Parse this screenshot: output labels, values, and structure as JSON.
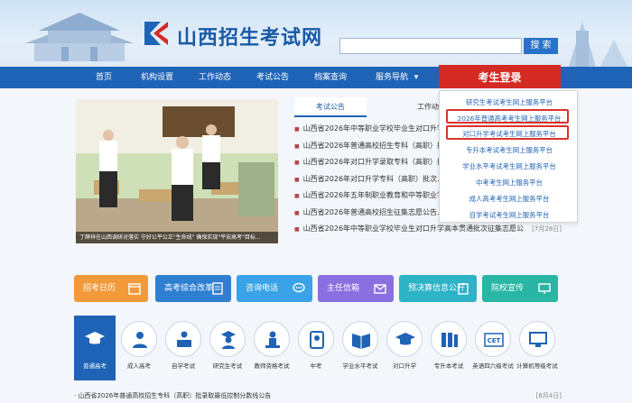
{
  "header": {
    "site_title": "山西招生考试网",
    "search_placeholder": "",
    "search_button": "搜 索"
  },
  "nav": {
    "items": [
      "首页",
      "机构设置",
      "工作动态",
      "考试公告",
      "档案查询",
      "服务导航"
    ],
    "dropdown_caret": "▾",
    "login_label": "考生登录"
  },
  "photo": {
    "caption": "丁薛祥在山西调研对落实 守好公平公正\"生命线\" 确保实现\"平安高考\"目标..."
  },
  "news": {
    "tabs": [
      "考试公告",
      "工作动"
    ],
    "items": [
      {
        "title": "山西省2026年中等职业学校毕业生对口升学…"
      },
      {
        "title": "山西省2026年普通高校招生专科（高职）批…"
      },
      {
        "title": "山西省2026年对口升学录取专科（高职）批次录…"
      },
      {
        "title": "山西省2026年对口升学专科（高职）批次…"
      },
      {
        "title": "山西省2026年五年制职业教育和中等职业学…"
      },
      {
        "title": "山西省2026年普通高校招生征集志愿公告…"
      },
      {
        "title": "山西省2026年中等职业学校毕业生对口升学高本贯通批次征集志愿公"
      }
    ],
    "last_date": "[7月28日]"
  },
  "dropdown": {
    "items": [
      "研究生考试考生网上服务平台",
      "2026年普通高考考生网上服务平台",
      "对口升学考试考生网上服务平台",
      "专升本考试考生网上服务平台",
      "学业水平考试考生网上服务平台",
      "中考考生网上服务平台",
      "成人高考考生网上服务平台",
      "自学考试考生网上服务平台"
    ]
  },
  "quick_links": [
    {
      "label": "招考日历",
      "color": "#f29a3a"
    },
    {
      "label": "高考综合改革",
      "color": "#2f7fd1"
    },
    {
      "label": "咨询电话",
      "color": "#3aa2e6"
    },
    {
      "label": "主任信箱",
      "color": "#8a6fe0"
    },
    {
      "label": "预决算信息公开",
      "color": "#2db3c6"
    },
    {
      "label": "院校宣传",
      "color": "#29b6a4"
    }
  ],
  "tiles": [
    {
      "label": "普通高考",
      "icon": "graduation-cap-icon"
    },
    {
      "label": "成人高考",
      "icon": "adult-student-icon"
    },
    {
      "label": "自学考试",
      "icon": "self-study-icon"
    },
    {
      "label": "研究生考试",
      "icon": "graduate-icon"
    },
    {
      "label": "教师资格考试",
      "icon": "teacher-icon"
    },
    {
      "label": "中考",
      "icon": "middle-school-icon"
    },
    {
      "label": "学业水平考试",
      "icon": "book-icon"
    },
    {
      "label": "对口升学",
      "icon": "cap-icon"
    },
    {
      "label": "专升本考试",
      "icon": "books-icon"
    },
    {
      "label": "英语四六级考试",
      "icon": "cet-icon"
    },
    {
      "label": "计算机等级考试",
      "icon": "computer-icon"
    }
  ],
  "tile_cet_text": "CET",
  "bottom_news": {
    "title": "· 山西省2026年普通高校招生专科（高职）批录取最低控制分数线公告",
    "date": "[8月4日]"
  },
  "colors": {
    "nav_blue": "#1f63b6",
    "login_red": "#d42a24",
    "highlight_red": "#d9322c"
  }
}
